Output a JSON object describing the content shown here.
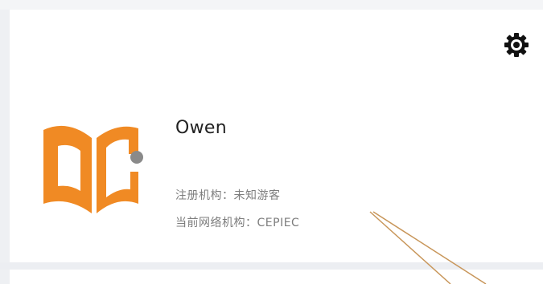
{
  "profile": {
    "name": "Owen",
    "registered_org": "注册机构：未知游客",
    "network_org": "当前网络机构：CEPIEC"
  },
  "icons": {
    "settings": "gear-icon",
    "avatar": "book-logo-icon"
  },
  "colors": {
    "logo_orange": "#f08a24",
    "logo_dot": "#8a8a8a",
    "annotation_line": "#c8965a"
  }
}
